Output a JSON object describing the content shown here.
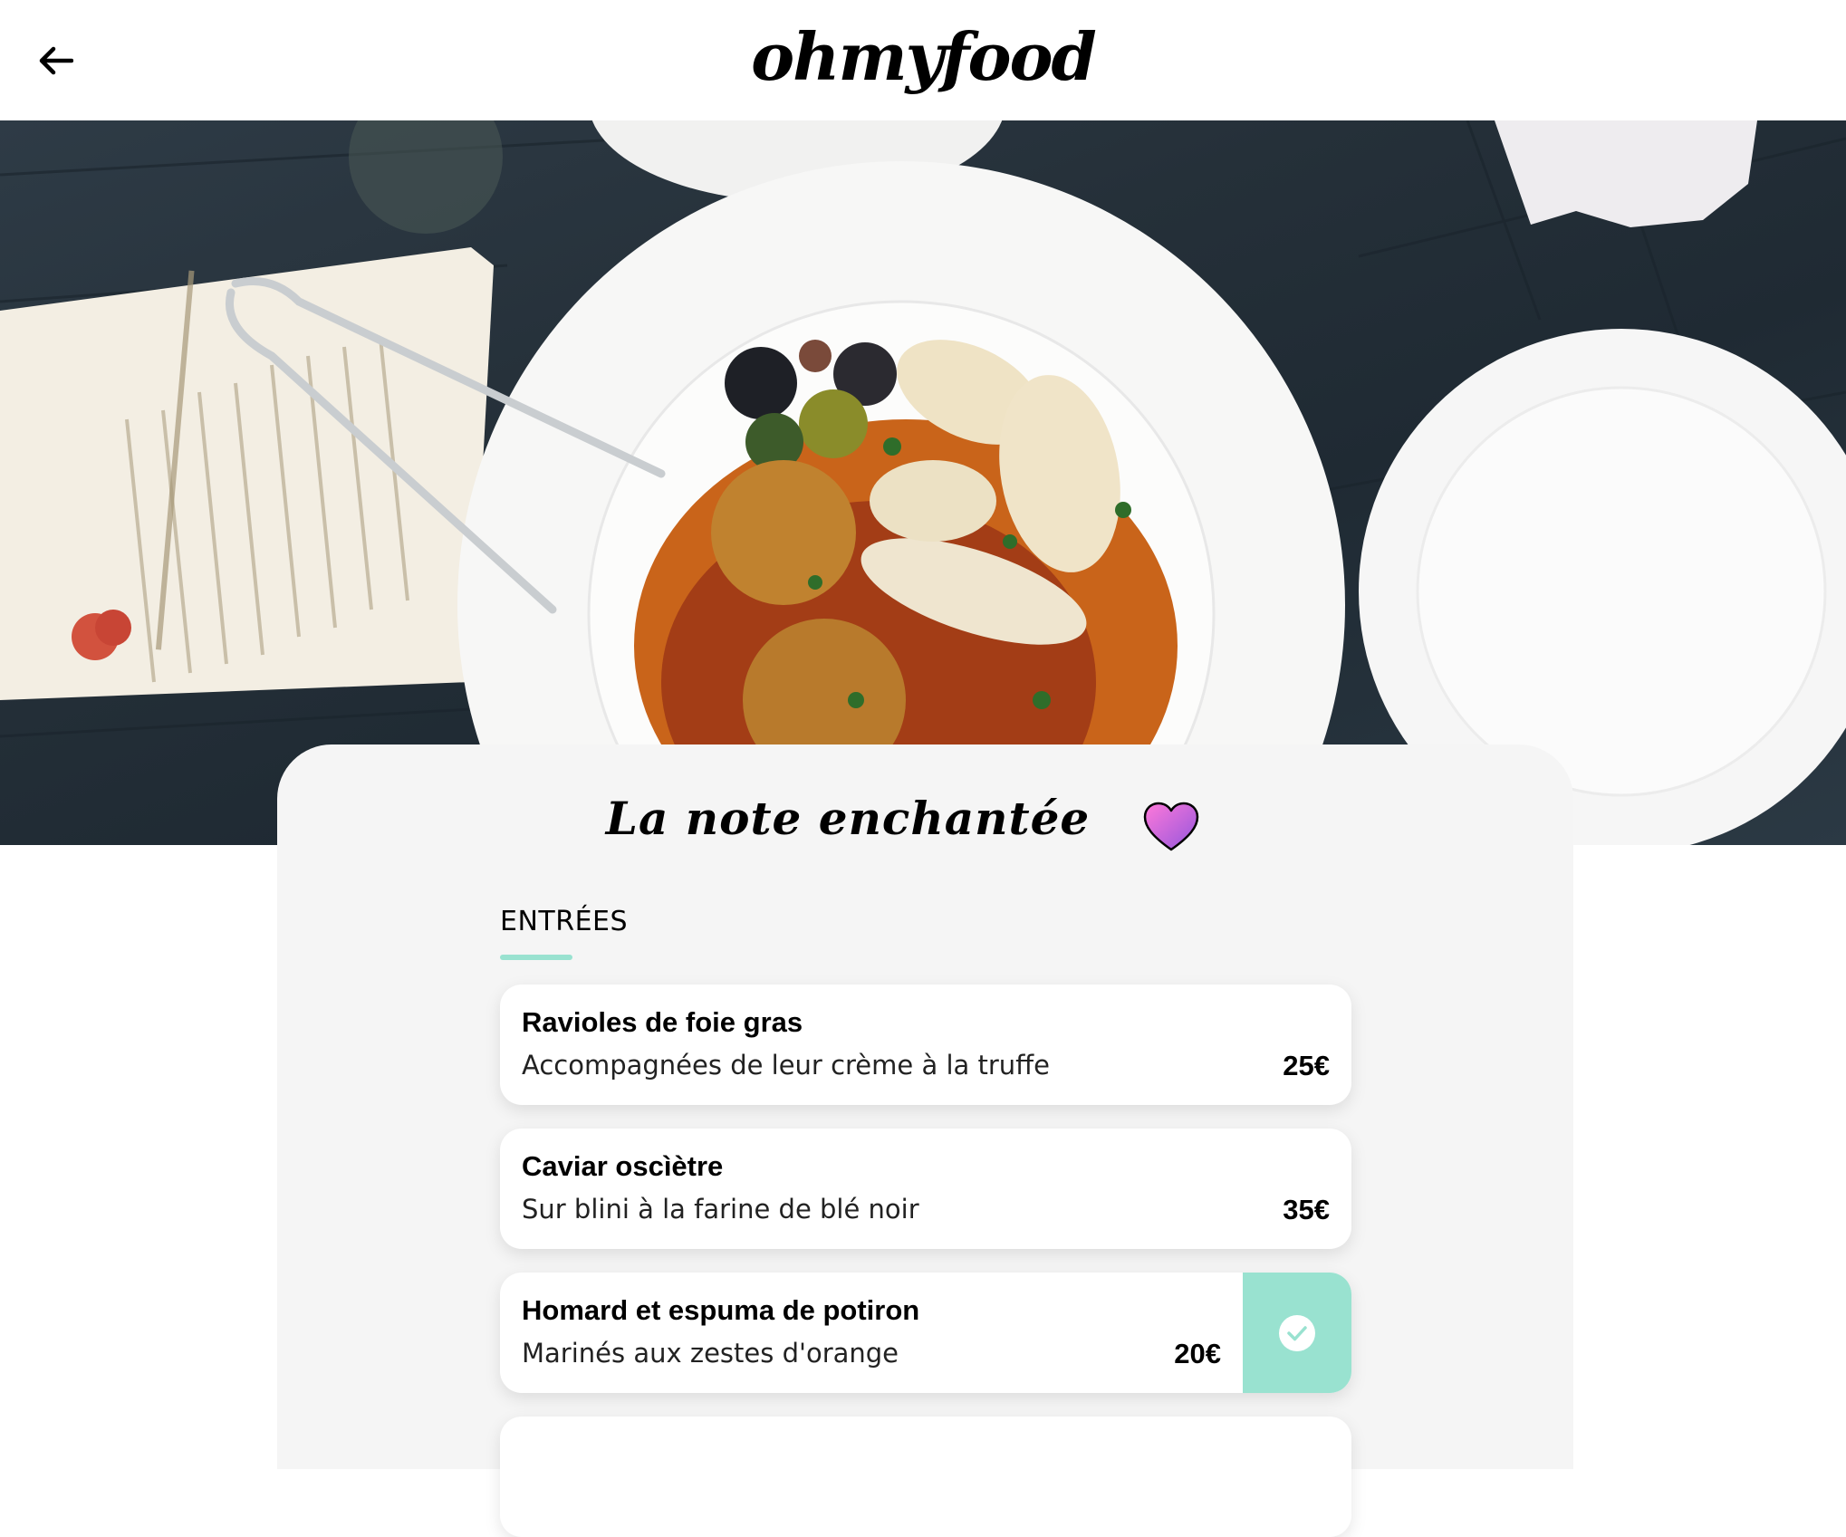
{
  "header": {
    "logo": "ohmyfood",
    "back_icon": "arrow-left-icon"
  },
  "restaurant": {
    "name": "La note enchantée",
    "favorite_icon": "heart-icon",
    "favorite_color": "#9356DC"
  },
  "menu": {
    "section_title": "ENTRÉES",
    "accent_color": "#99E2D0",
    "dishes": [
      {
        "name": "Ravioles de foie gras",
        "description": "Accompagnées de leur crème à la truffe",
        "price": "25€",
        "selected": false
      },
      {
        "name": "Caviar oscìètre",
        "description": "Sur blini à la farine de blé noir",
        "price": "35€",
        "selected": false
      },
      {
        "name": "Homard et espuma de potiron",
        "description": "Marinés aux zestes d'orange",
        "price": "20€",
        "selected": true
      }
    ],
    "check_icon": "check-circle-icon"
  }
}
